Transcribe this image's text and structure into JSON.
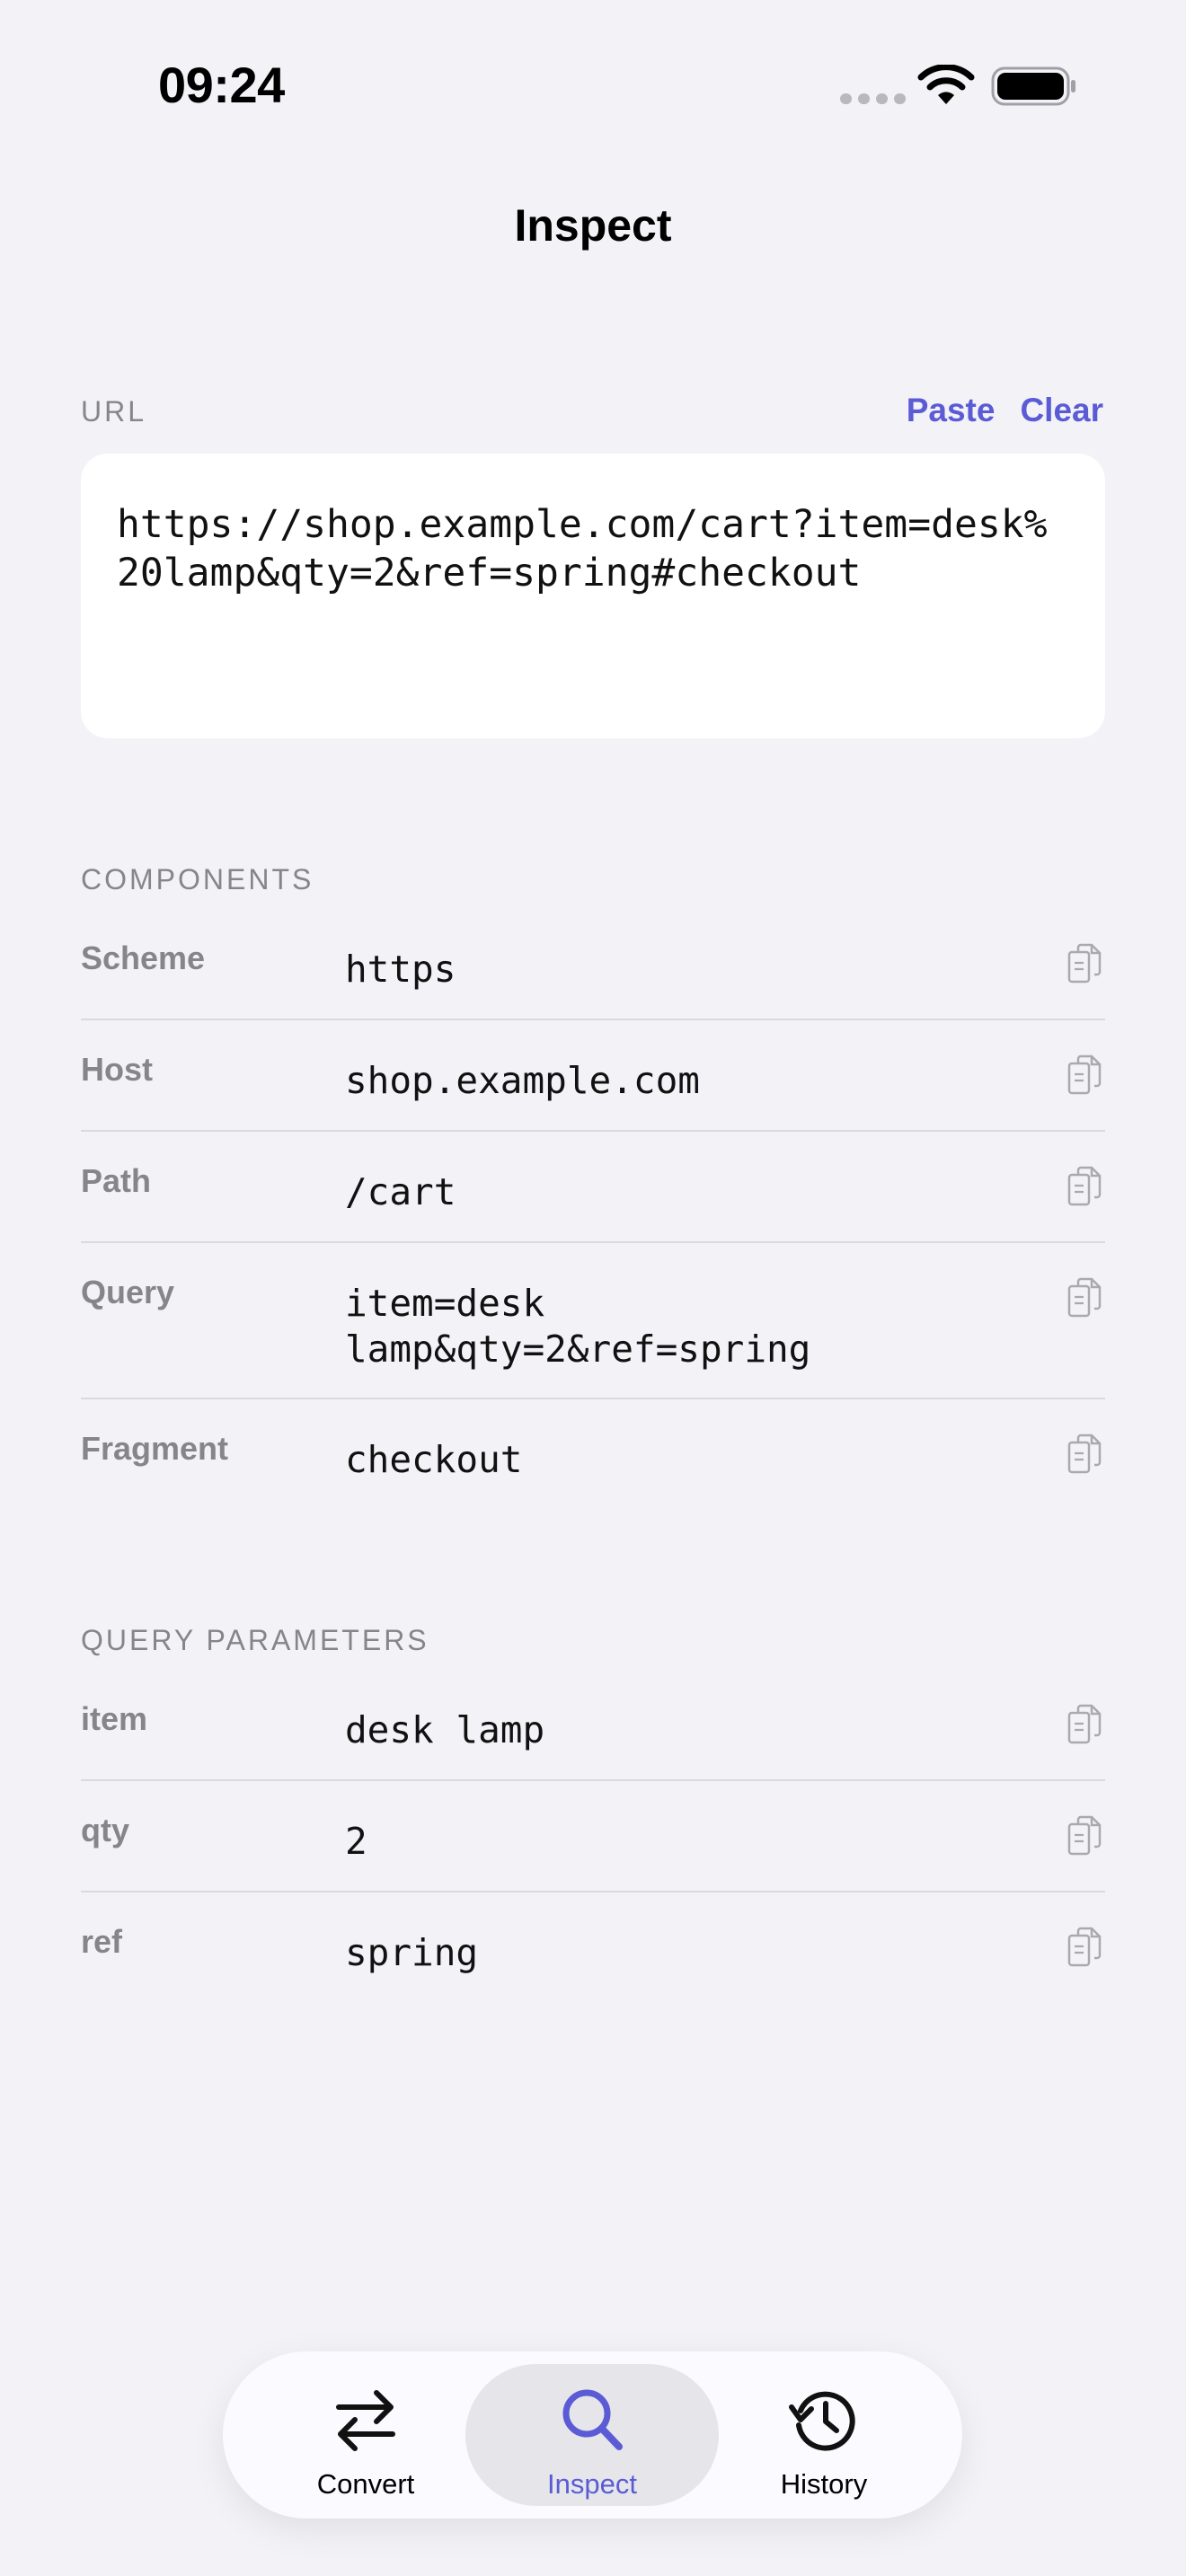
{
  "status_bar": {
    "time": "09:24"
  },
  "nav": {
    "title": "Inspect"
  },
  "url_section": {
    "header": "URL",
    "paste_label": "Paste",
    "clear_label": "Clear",
    "url_value": "https://shop.example.com/cart?item=desk%20lamp&qty=2&ref=spring#checkout"
  },
  "components": {
    "header": "COMPONENTS",
    "rows": [
      {
        "label": "Scheme",
        "value": "https"
      },
      {
        "label": "Host",
        "value": "shop.example.com"
      },
      {
        "label": "Path",
        "value": "/cart"
      },
      {
        "label": "Query",
        "value": "item=desk\nlamp&qty=2&ref=spring"
      },
      {
        "label": "Fragment",
        "value": "checkout"
      }
    ]
  },
  "query_parameters": {
    "header": "QUERY PARAMETERS",
    "rows": [
      {
        "label": "item",
        "value": "desk lamp"
      },
      {
        "label": "qty",
        "value": "2"
      },
      {
        "label": "ref",
        "value": "spring"
      }
    ]
  },
  "tab_bar": {
    "tabs": [
      {
        "label": "Convert",
        "icon": "arrows-left-right-icon",
        "active": false
      },
      {
        "label": "Inspect",
        "icon": "magnifier-icon",
        "active": true
      },
      {
        "label": "History",
        "icon": "clock-arrow-icon",
        "active": false
      }
    ]
  },
  "colors": {
    "accent": "#5B5BD6",
    "background": "#F2F2F7",
    "secondary_text": "#85858B",
    "separator": "#D9D9DE"
  }
}
